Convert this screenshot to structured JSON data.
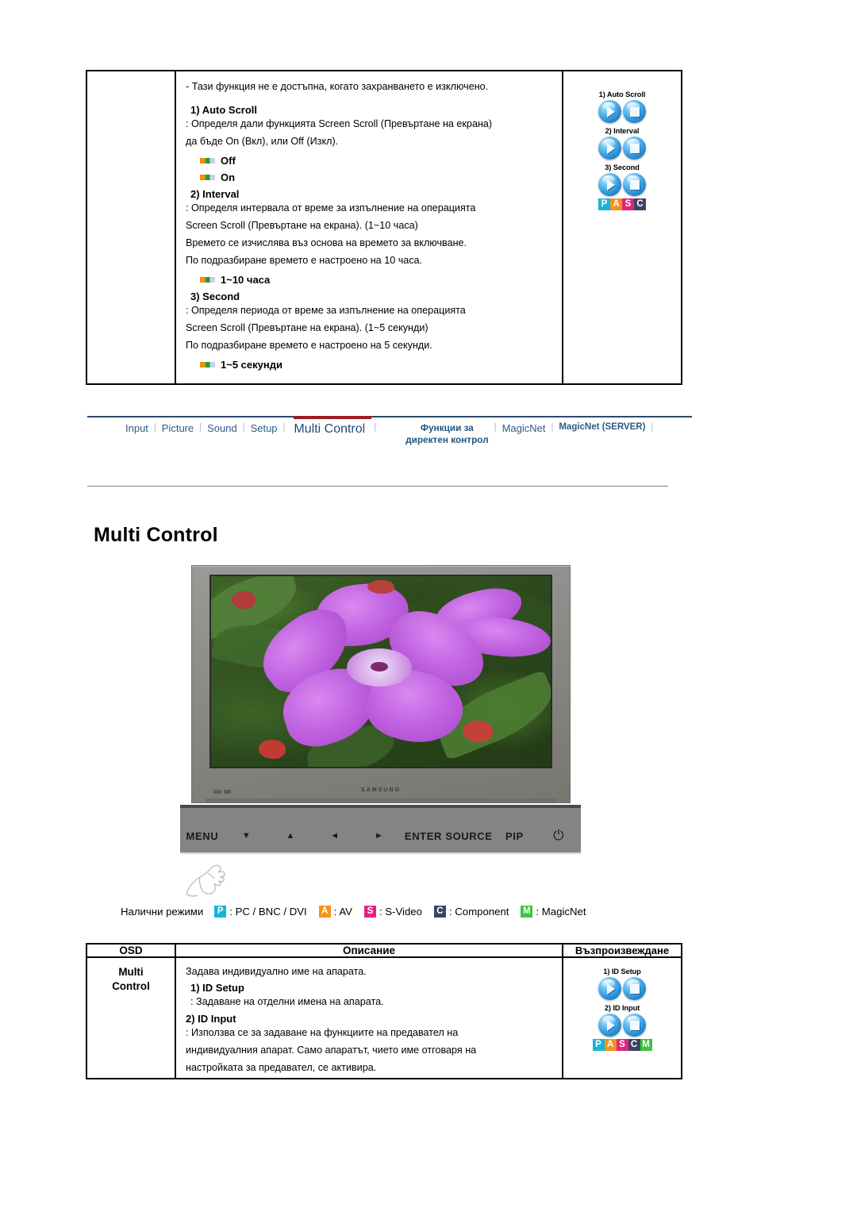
{
  "top_section": {
    "intro_note": "- Тази функция не е достъпна, когато захранването е изключено.",
    "items": [
      {
        "heading": "1) Auto Scroll",
        "lines": [
          ": Определя дали функцията Screen Scroll (Превъртане на екрана)",
          "да бъде On (Вкл), или Off (Изкл)."
        ],
        "bullets": [
          "Off",
          "On"
        ]
      },
      {
        "heading": "2) Interval",
        "lines": [
          ": Определя интервала от време за изпълнение на операцията",
          "Screen Scroll (Превъртане на екрана). (1~10 часа)",
          " Времето се изчислява въз основа на времето за включване.",
          " По подразбиране времето е настроено на 10 часа."
        ],
        "bullets": [
          "1~10 часа"
        ]
      },
      {
        "heading": "3) Second",
        "lines": [
          ":  Определя периода от време за изпълнение на операцията",
          "   Screen Scroll (Превъртане на екрана). (1~5 секунди)",
          "   По подразбиране времето е настроено на 5 секунди."
        ],
        "bullets": [
          "1~5 секунди"
        ]
      }
    ],
    "play_groups": [
      {
        "caption": "1) Auto Scroll",
        "buttons": [
          "play",
          "stop"
        ]
      },
      {
        "caption": "2) Interval",
        "buttons": [
          "play",
          "stop"
        ]
      },
      {
        "caption": "3) Second",
        "buttons": [
          "play",
          "stop"
        ]
      }
    ],
    "badge": [
      "P",
      "A",
      "S",
      "C"
    ]
  },
  "navbar": {
    "items": [
      {
        "label": "Input",
        "style": "normal"
      },
      {
        "label": "Picture",
        "style": "normal"
      },
      {
        "label": "Sound",
        "style": "normal"
      },
      {
        "label": "Setup",
        "style": "normal"
      },
      {
        "label": "Multi Control",
        "style": "active"
      },
      {
        "label": "Функции за\nдиректен контрол",
        "style": "two-line"
      },
      {
        "label": "MagicNet",
        "style": "normal"
      },
      {
        "label": "MagicNet (SERVER)",
        "style": "small-bold"
      }
    ],
    "separator": "|",
    "active_bar_color": "#9e1b23",
    "link_color": "#2d5b86"
  },
  "page_title": "Multi Control",
  "monitor": {
    "brand": "SAMSUNG",
    "screen_content": "Close-up photo of a purple Tibouchina flower with green leaves",
    "control_buttons": [
      {
        "label": "MENU",
        "kind": "text"
      },
      {
        "label": "▼",
        "kind": "glyph"
      },
      {
        "label": "▲",
        "kind": "glyph"
      },
      {
        "label": "◄",
        "kind": "glyph"
      },
      {
        "label": "►",
        "kind": "glyph"
      },
      {
        "label": "ENTER",
        "kind": "text"
      },
      {
        "label": "SOURCE",
        "kind": "text"
      },
      {
        "label": "PIP",
        "kind": "text"
      },
      {
        "label": "⏻",
        "kind": "power"
      }
    ]
  },
  "modes": {
    "label": "Налични режими",
    "entries": [
      {
        "badge": "P",
        "color": "#18b4d8",
        "text": ": PC / BNC / DVI"
      },
      {
        "badge": "A",
        "color": "#f5911e",
        "text": ": AV"
      },
      {
        "badge": "S",
        "color": "#e0247e",
        "text": ": S-Video"
      },
      {
        "badge": "C",
        "color": "#3d4463",
        "text": ": Component"
      },
      {
        "badge": "M",
        "color": "#3bc53b",
        "text": ": MagicNet"
      }
    ]
  },
  "bottom_table": {
    "headers": [
      "OSD",
      "Описание",
      "Възпроизвеждане"
    ],
    "row": {
      "osd": "Multi\nControl",
      "osd_line1": "Multi",
      "osd_line2": "Control",
      "description_intro": "Задава индивидуално име на апарата.",
      "items": [
        {
          "heading": "1) ID Setup",
          "lines": [
            ": Задаване на отделни имена на апарата."
          ]
        },
        {
          "heading": "2) ID Input",
          "lines": [
            ": Използва се за задаване на функциите на предавател на",
            "индивидуалния апарат. Само апаратът, чието име отговаря на",
            "настройката за предавател, се активира."
          ]
        }
      ],
      "play_groups": [
        {
          "caption": "1) ID Setup",
          "buttons": [
            "play",
            "stop"
          ]
        },
        {
          "caption": "2) ID Input",
          "buttons": [
            "play",
            "stop"
          ]
        }
      ],
      "badge": [
        "P",
        "A",
        "S",
        "C",
        "M"
      ]
    }
  }
}
